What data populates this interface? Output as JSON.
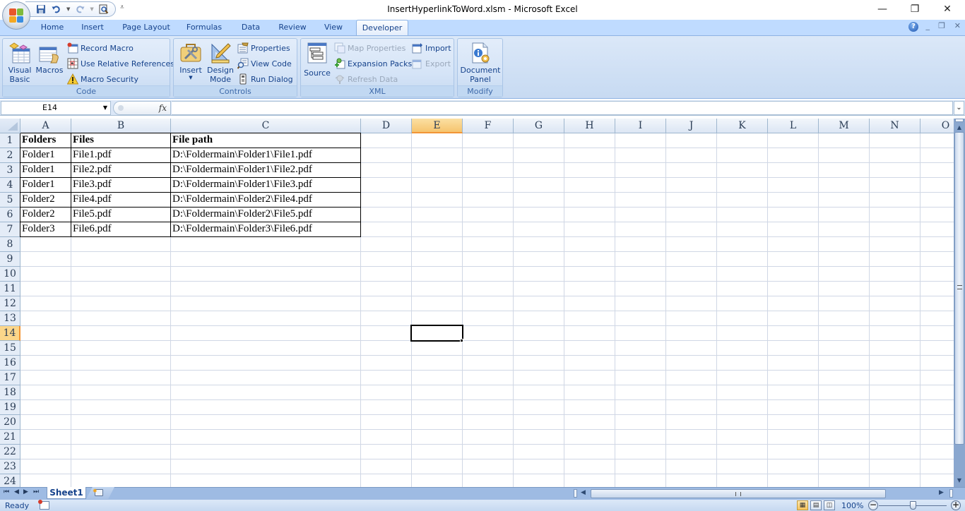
{
  "window": {
    "title": "InsertHyperlinkToWord.xlsm - Microsoft Excel",
    "minimize": "—",
    "restore": "❐",
    "close": "✕"
  },
  "quick_access": {
    "save_icon": "save-icon",
    "undo_icon": "undo-icon",
    "redo_icon": "redo-icon",
    "print_preview_icon": "print-preview-icon",
    "customize": "customize-quick-access-icon"
  },
  "tabs": [
    {
      "label": "Home"
    },
    {
      "label": "Insert"
    },
    {
      "label": "Page Layout"
    },
    {
      "label": "Formulas"
    },
    {
      "label": "Data"
    },
    {
      "label": "Review"
    },
    {
      "label": "View"
    },
    {
      "label": "Developer",
      "active": true
    }
  ],
  "ribbon": {
    "code": {
      "label": "Code",
      "visual_basic": "Visual Basic",
      "visual_basic_l1": "Visual",
      "visual_basic_l2": "Basic",
      "macros": "Macros",
      "record_macro": "Record Macro",
      "use_relative_references": "Use Relative References",
      "macro_security": "Macro Security"
    },
    "controls": {
      "label": "Controls",
      "insert": "Insert",
      "design_mode_l1": "Design",
      "design_mode_l2": "Mode",
      "properties": "Properties",
      "view_code": "View Code",
      "run_dialog": "Run Dialog"
    },
    "xml": {
      "label": "XML",
      "source": "Source",
      "map_properties": "Map Properties",
      "expansion_packs": "Expansion Packs",
      "refresh_data": "Refresh Data",
      "import": "Import",
      "export": "Export"
    },
    "modify": {
      "label": "Modify",
      "document_panel_l1": "Document",
      "document_panel_l2": "Panel"
    }
  },
  "formula_bar": {
    "name_box": "E14",
    "fx": "fx",
    "formula": ""
  },
  "grid": {
    "columns": [
      "A",
      "B",
      "C",
      "D",
      "E",
      "F",
      "G",
      "H",
      "I",
      "J",
      "K",
      "L",
      "M",
      "N",
      "O"
    ],
    "selected_column": "E",
    "rows": [
      "1",
      "2",
      "3",
      "4",
      "5",
      "6",
      "7",
      "8",
      "9",
      "10",
      "11",
      "12",
      "13",
      "14",
      "15",
      "16",
      "17",
      "18",
      "19",
      "20",
      "21",
      "22",
      "23",
      "24"
    ],
    "selected_row": "14",
    "active_cell": "E14",
    "table": {
      "headers": [
        "Folders",
        "Files",
        "File path"
      ],
      "data": [
        [
          "Folder1",
          "File1.pdf",
          "D:\\Foldermain\\Folder1\\File1.pdf"
        ],
        [
          "Folder1",
          "File2.pdf",
          "D:\\Foldermain\\Folder1\\File2.pdf"
        ],
        [
          "Folder1",
          "File3.pdf",
          "D:\\Foldermain\\Folder1\\File3.pdf"
        ],
        [
          "Folder2",
          "File4.pdf",
          "D:\\Foldermain\\Folder2\\File4.pdf"
        ],
        [
          "Folder2",
          "File5.pdf",
          "D:\\Foldermain\\Folder2\\File5.pdf"
        ],
        [
          "Folder3",
          "File6.pdf",
          "D:\\Foldermain\\Folder3\\File6.pdf"
        ]
      ]
    }
  },
  "sheets": {
    "tabs": [
      "Sheet1"
    ],
    "active": "Sheet1"
  },
  "status": {
    "mode": "Ready",
    "zoom": "100%",
    "zoom_percent": 100
  },
  "colors": {
    "accent_tab_text": "#15428b",
    "selection_header": "#f6c46e",
    "ribbon_bg": "#d5e4f7",
    "gridline": "#d0d7e5"
  }
}
